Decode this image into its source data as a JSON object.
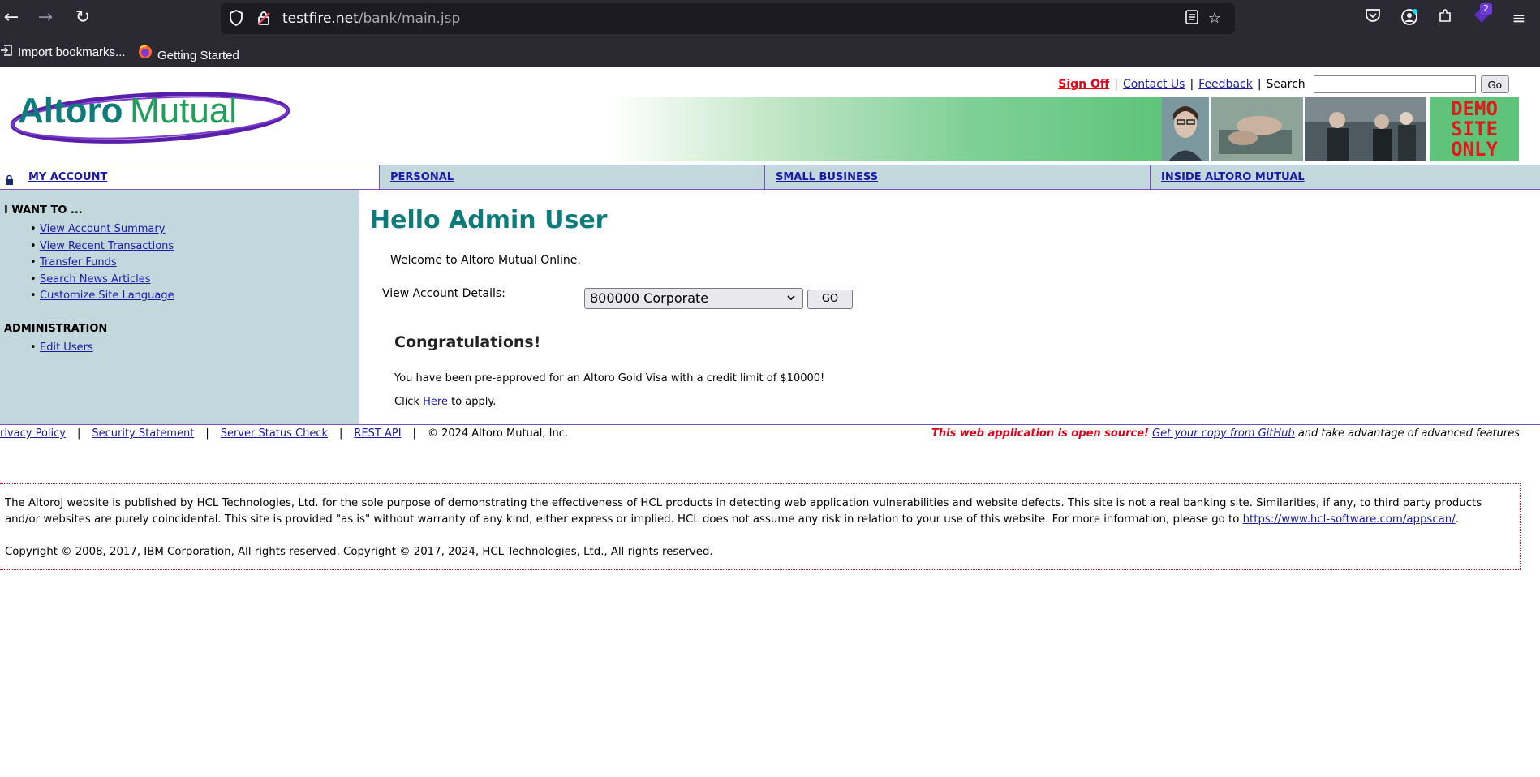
{
  "browser": {
    "url_host": "testfire.net",
    "url_path": "/bank/main.jsp",
    "badge_count": "2",
    "bookmarks": [
      {
        "label": "Import bookmarks..."
      },
      {
        "label": "Getting Started"
      }
    ]
  },
  "header": {
    "sign_off": "Sign Off",
    "contact_us": "Contact Us",
    "feedback": "Feedback",
    "search_label": "Search",
    "search_value": "",
    "go_label": "Go",
    "logo_text_1": "Altoro",
    "logo_text_2": "Mutual",
    "demo_text": [
      "DEMO",
      "SITE",
      "ONLY"
    ]
  },
  "tabs": [
    {
      "label": "MY ACCOUNT"
    },
    {
      "label": "PERSONAL"
    },
    {
      "label": "SMALL BUSINESS"
    },
    {
      "label": "INSIDE ALTORO MUTUAL"
    }
  ],
  "sidebar": {
    "heading": "I WANT TO ...",
    "items": [
      {
        "label": "View Account Summary"
      },
      {
        "label": "View Recent Transactions"
      },
      {
        "label": "Transfer Funds"
      },
      {
        "label": "Search News Articles"
      },
      {
        "label": "Customize Site Language"
      }
    ],
    "admin_heading": "ADMINISTRATION",
    "admin_items": [
      {
        "label": "Edit Users"
      }
    ]
  },
  "main": {
    "greeting": "Hello Admin User",
    "welcome": "Welcome to Altoro Mutual Online.",
    "view_account_label": "View Account Details:",
    "selected_account": "800000 Corporate",
    "go_label": "GO",
    "congrats_title": "Congratulations!",
    "preapproved": "You have been pre-approved for an Altoro Gold Visa with a credit limit of $10000!",
    "click_prefix": "Click",
    "click_link": "Here",
    "click_suffix": "to apply."
  },
  "footer": {
    "privacy": "rivacy Policy",
    "security": "Security Statement",
    "server_status": "Server Status Check",
    "rest_api": "REST API",
    "copyright": "© 2024 Altoro Mutual, Inc.",
    "open_source": "This web application is open source!",
    "github_link": "Get your copy from GitHub",
    "advantage": "and take advantage of advanced features"
  },
  "disclaimer": {
    "text": "The AltoroJ website is published by HCL Technologies, Ltd. for the sole purpose of demonstrating the effectiveness of HCL products in detecting web application vulnerabilities and website defects. This site is not a real banking site. Similarities, if any, to third party products and/or websites are purely coincidental. This site is provided \"as is\" without warranty of any kind, either express or implied. HCL does not assume any risk in relation to your use of this website. For more information, please go to",
    "link": "https://www.hcl-software.com/appscan/",
    "copyright": "Copyright © 2008, 2017, IBM Corporation, All rights reserved. Copyright © 2017, 2024, HCL Technologies, Ltd., All rights reserved."
  },
  "colors": {
    "brand_teal": "#0c7b7a",
    "nav_bg": "#c3d8dc",
    "border_purple": "#7b51c2",
    "sign_off_red": "#e3001b"
  },
  "icons": [
    "back-icon",
    "forward-icon",
    "reload-icon",
    "shield-icon",
    "lock-insecure-icon",
    "reader-view-icon",
    "star-icon",
    "pocket-icon",
    "account-icon",
    "extensions-icon",
    "extension-badge-icon",
    "menu-icon",
    "import-icon",
    "firefox-icon",
    "padlock-icon"
  ]
}
